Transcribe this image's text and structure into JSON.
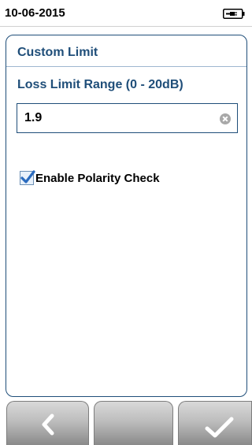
{
  "status": {
    "date": "10-06-2015",
    "battery_icon": "battery-plug-icon"
  },
  "panel": {
    "title": "Custom Limit",
    "range_label": "Loss Limit Range (0 - 20dB)",
    "value": "1.9",
    "clear_icon": "clear-icon",
    "polarity": {
      "label": "Enable Polarity Check",
      "checked": true
    }
  },
  "softkeys": [
    {
      "icon": "chevron-left-icon"
    },
    {
      "icon": ""
    },
    {
      "icon": "checkmark-icon"
    }
  ],
  "colors": {
    "accent": "#1f4e79",
    "check": "#2a6bbf"
  }
}
